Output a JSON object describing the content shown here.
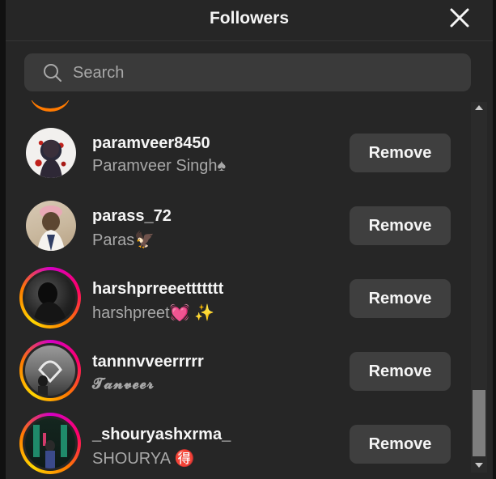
{
  "dialog": {
    "title": "Followers",
    "close_icon": "close-icon"
  },
  "search": {
    "placeholder": "Search",
    "value": "",
    "icon": "search-icon"
  },
  "followers": [
    {
      "username": "paramveer8450",
      "full_name": "Paramveer Singh♠",
      "remove_label": "Remove",
      "story_ring": false
    },
    {
      "username": "parass_72",
      "full_name": "Paras🦅",
      "remove_label": "Remove",
      "story_ring": false
    },
    {
      "username": "harshprreeettttttt",
      "full_name": "harshpreet💓 ✨",
      "remove_label": "Remove",
      "story_ring": true
    },
    {
      "username": "tannnvveerrrrr",
      "full_name": "𝓣𝓪𝓷𝓿𝓮𝓮𝓻",
      "remove_label": "Remove",
      "story_ring": true
    },
    {
      "username": "_shouryashxrma_",
      "full_name": "SHOURYA 🉐",
      "remove_label": "Remove",
      "story_ring": true
    }
  ],
  "colors": {
    "background": "#262626",
    "button": "#3f3f3f",
    "secondary_text": "#a8a8a8",
    "story_ring_start": "#d300c5",
    "story_ring_end": "#ffd600"
  }
}
